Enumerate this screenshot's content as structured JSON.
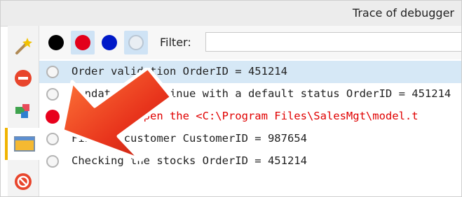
{
  "window": {
    "title": "Trace of debugger"
  },
  "sidebar": {
    "items": [
      {
        "icon": "wand-icon"
      },
      {
        "icon": "stop-icon"
      },
      {
        "icon": "puzzle-icon"
      },
      {
        "icon": "panel-icon",
        "active": true
      },
      {
        "icon": "disabled-icon"
      }
    ]
  },
  "toolbar": {
    "filters": [
      {
        "color": "#000000",
        "selected": false
      },
      {
        "color": "#e3001b",
        "selected": true
      },
      {
        "color": "#0019c8",
        "selected": false
      },
      {
        "color": "hollow",
        "selected": true
      }
    ],
    "filter_label": "Filter:",
    "filter_value": ""
  },
  "trace": {
    "rows": [
      {
        "text": "Order validation OrderID = 451214",
        "status": "info",
        "selected": true
      },
      {
        "text": "Mandatory, continue with a default status OrderID = 451214",
        "status": "info",
        "selected": false
      },
      {
        "text": "Unable to open the <C:\\Program Files\\SalesMgt\\model.t",
        "status": "error",
        "selected": false
      },
      {
        "text": "Finding customer CustomerID = 987654",
        "status": "info",
        "selected": false
      },
      {
        "text": "Checking the stocks OrderID = 451214",
        "status": "info",
        "selected": false
      }
    ]
  },
  "colors": {
    "accent": "#f0b400",
    "error": "#e00000",
    "selection": "#d6e8f6"
  }
}
